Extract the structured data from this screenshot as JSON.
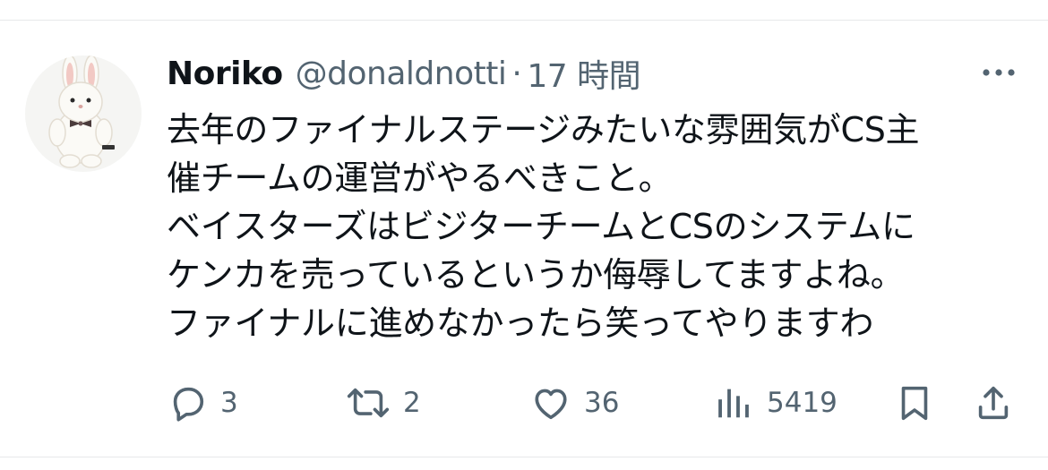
{
  "tweet": {
    "author_name": "Noriko",
    "handle": "@donaldnotti",
    "separator": "·",
    "time": "17 時間",
    "text_lines": [
      "去年のファイナルステージみたいな雰囲気がCS主",
      "催チームの運営がやるべきこと。",
      "ベイスターズはビジターチームとCSのシステムに",
      "ケンカを売っているというか侮辱してますよね。",
      "ファイナルに進めなかったら笑ってやりますわ"
    ]
  },
  "actions": {
    "reply_count": "3",
    "retweet_count": "2",
    "like_count": "36",
    "view_count": "5419"
  },
  "icons": {
    "avatar": "rabbit-plush-avatar",
    "more": "more-dots-icon",
    "reply": "reply-bubble-icon",
    "retweet": "retweet-icon",
    "like": "heart-icon",
    "views": "views-bar-chart-icon",
    "bookmark": "bookmark-icon",
    "share": "share-icon"
  },
  "colors": {
    "text": "#0f1419",
    "secondary": "#536471",
    "border": "#e7e9ea"
  }
}
